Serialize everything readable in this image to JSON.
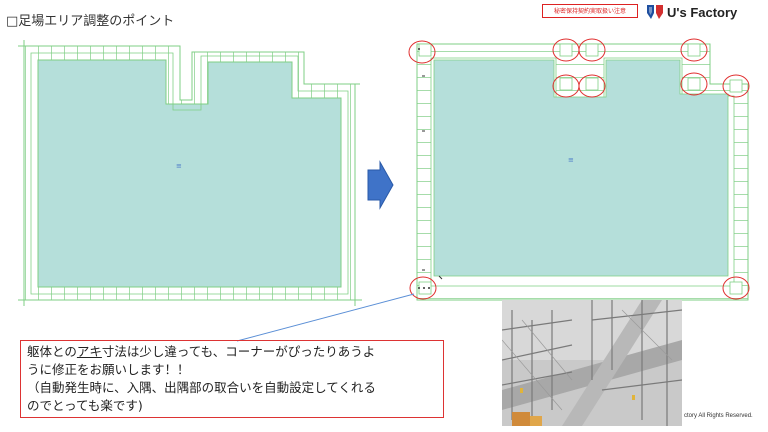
{
  "header": {
    "title": "□足場エリア調整のポイント",
    "confidential_label": "秘密保持契約実取扱い注意",
    "brand_name": "U's Factory"
  },
  "callout": {
    "line1_pre": "躯体との",
    "line1_underlined": "アキ",
    "line1_post": "寸法は少し違っても、コーナーがぴったりあうよ",
    "line2": "うに修正をお願いします！！",
    "line3": "（自動発生時に、入隅、出隅部の取合いを自動設定してくれる",
    "line4": "のでとっても楽です)"
  },
  "footer": {
    "copyright": "ctory All Rights Reserved."
  },
  "colors": {
    "area_fill": "#b5dfda",
    "scaffold_line": "#7fcf84",
    "highlight": "#e03030",
    "arrow_fill": "#3f73c8",
    "callout_border": "#d33333",
    "brand_blue": "#1e4fa0",
    "brand_red": "#d32f2f"
  },
  "icons": [
    "right-arrow-icon",
    "brand-logo-icon",
    "callout-pointer-line"
  ]
}
